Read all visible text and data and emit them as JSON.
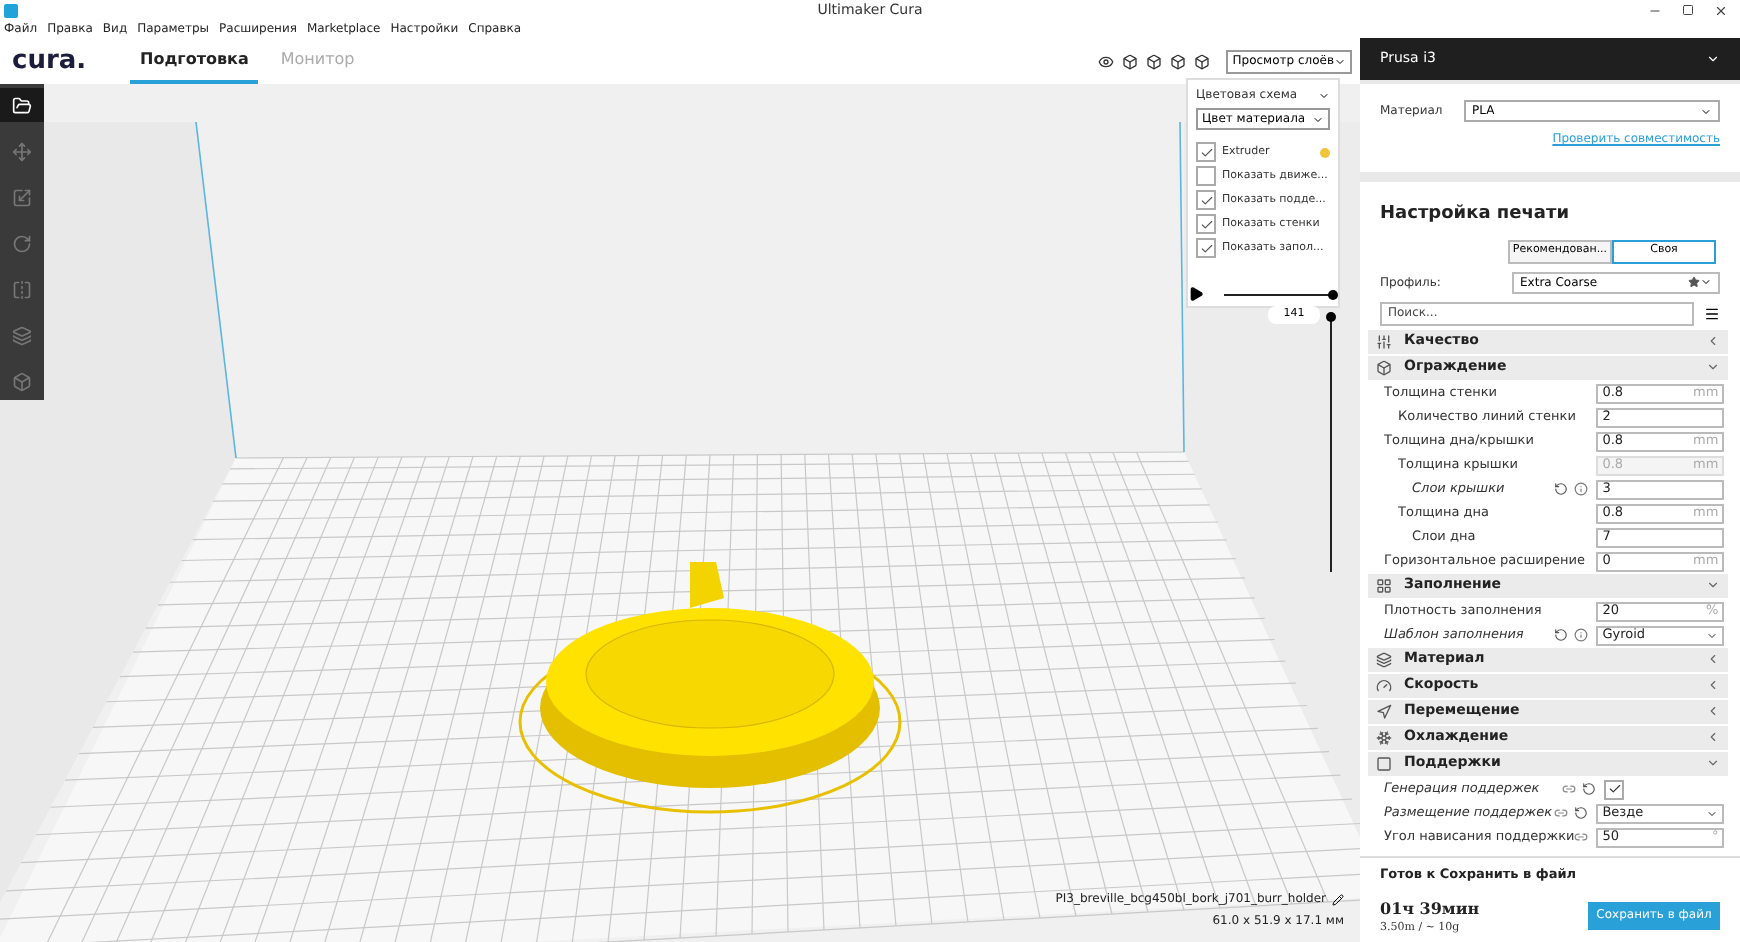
{
  "window": {
    "title": "Ultimaker Cura"
  },
  "menu": [
    "Файл",
    "Правка",
    "Вид",
    "Параметры",
    "Расширения",
    "Marketplace",
    "Настройки",
    "Справка"
  ],
  "header": {
    "logo": "cura.",
    "tabs": [
      {
        "label": "Подготовка",
        "selected": true
      },
      {
        "label": "Монитор",
        "selected": false
      }
    ],
    "view_dropdown": "Просмотр слоёв"
  },
  "layer_view": {
    "color_scheme_label": "Цветовая схема",
    "color_scheme": "Цвет материала",
    "options": [
      {
        "label": "Extruder",
        "checked": true,
        "color": "#f0c43c"
      },
      {
        "label": "Показать движе...",
        "checked": false
      },
      {
        "label": "Показать подде...",
        "checked": true
      },
      {
        "label": "Показать стенки",
        "checked": true
      },
      {
        "label": "Показать запол...",
        "checked": true
      }
    ],
    "horizontal_slider": {
      "level": 1
    },
    "layer_number": "141",
    "vertical_slider": {
      "level": 1
    }
  },
  "object_info": {
    "name": "PI3_breville_bcg450bl_bork_j701_burr_holder",
    "dimensions": "61.0 x 51.9 x 17.1 мм"
  },
  "printer": {
    "name": "Prusa i3",
    "material_label": "Материал",
    "material": "PLA",
    "compatibility_link": "Проверить совместимость"
  },
  "print_setup": {
    "title": "Настройка печати",
    "modes": [
      {
        "label": "Рекомендован...",
        "selected": false
      },
      {
        "label": "Своя",
        "selected": true
      }
    ],
    "profile_label": "Профиль:",
    "profile": "Extra Coarse",
    "search_placeholder": "Поиск...",
    "settings": [
      {
        "kind": "category",
        "label": "Качество",
        "expanded": false
      },
      {
        "kind": "category",
        "label": "Ограждение",
        "expanded": true,
        "children": [
          {
            "kind": "text",
            "label": "Толщина стенки",
            "value": "0.8",
            "unit": "mm",
            "children": [
              {
                "kind": "text",
                "label": "Количество линий стенки",
                "value": "2"
              }
            ]
          },
          {
            "kind": "text",
            "label": "Толщина дна/крышки",
            "value": "0.8",
            "unit": "mm",
            "children": [
              {
                "kind": "text",
                "label": "Толщина крышки",
                "value": "0.8",
                "unit": "mm",
                "disabled": true,
                "children": [
                  {
                    "kind": "text",
                    "label": "Слои крышки",
                    "value": "3",
                    "reset": true,
                    "info": true
                  }
                ]
              },
              {
                "kind": "text",
                "label": "Толщина дна",
                "value": "0.8",
                "unit": "mm",
                "children": [
                  {
                    "kind": "text",
                    "label": "Слои дна",
                    "value": "7"
                  }
                ]
              }
            ]
          },
          {
            "kind": "text",
            "label": "Горизонтальное расширение",
            "value": "0",
            "unit": "mm"
          }
        ]
      },
      {
        "kind": "category",
        "label": "Заполнение",
        "expanded": true,
        "children": [
          {
            "kind": "text",
            "label": "Плотность заполнения",
            "value": "20",
            "unit": "%"
          },
          {
            "kind": "dropdown",
            "label": "Шаблон заполнения",
            "value": "Gyroid",
            "reset": true,
            "info": true
          }
        ]
      },
      {
        "kind": "category",
        "label": "Материал",
        "expanded": false
      },
      {
        "kind": "category",
        "label": "Скорость",
        "expanded": false
      },
      {
        "kind": "category",
        "label": "Перемещение",
        "expanded": false
      },
      {
        "kind": "category",
        "label": "Охлаждение",
        "expanded": false
      },
      {
        "kind": "category",
        "label": "Поддержки",
        "expanded": true,
        "children": [
          {
            "kind": "checkbox",
            "label": "Генерация поддержек",
            "checked": true,
            "linked": true,
            "reset": true
          },
          {
            "kind": "dropdown",
            "label": "Размещение поддержек",
            "value": "Везде",
            "linked": true,
            "reset": true
          },
          {
            "kind": "text",
            "label": "Угол нависания поддержки",
            "value": "50",
            "unit": "°",
            "linked": true
          }
        ]
      }
    ]
  },
  "output": {
    "status": "Готов к Сохранить в файл",
    "time": "01ч 39мин",
    "usage": "3.50m / ~ 10g",
    "save_button": "Сохранить в файл"
  }
}
